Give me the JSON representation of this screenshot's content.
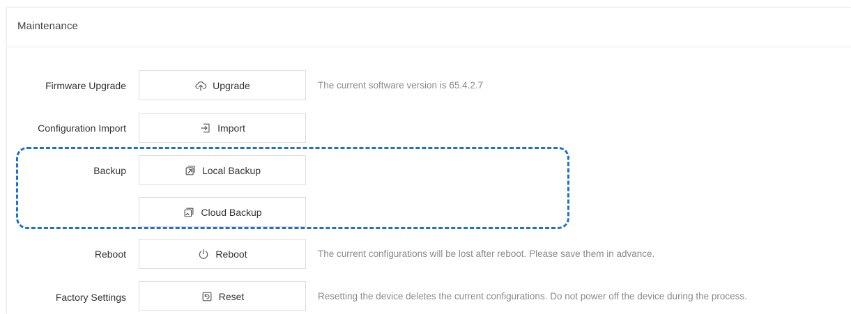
{
  "panel": {
    "title": "Maintenance"
  },
  "rows": {
    "firmware": {
      "label": "Firmware Upgrade",
      "button": "Upgrade",
      "icon": "cloud-upload-icon",
      "hint": "The current software version is 65.4.2.7"
    },
    "config_import": {
      "label": "Configuration Import",
      "button": "Import",
      "icon": "import-icon"
    },
    "backup": {
      "label": "Backup",
      "local_button": "Local Backup",
      "local_icon": "local-backup-icon",
      "cloud_button": "Cloud Backup",
      "cloud_icon": "cloud-backup-icon"
    },
    "reboot": {
      "label": "Reboot",
      "button": "Reboot",
      "icon": "power-icon",
      "hint": "The current configurations will be lost after reboot. Please save them in advance."
    },
    "factory": {
      "label": "Factory Settings",
      "button": "Reset",
      "icon": "reset-icon",
      "hint": "Resetting the device deletes the current configurations. Do not power off the device during the process."
    }
  },
  "colors": {
    "highlight": "#1f6fcf",
    "hint_text": "#8a8a8a",
    "border": "#dcdcdc"
  }
}
